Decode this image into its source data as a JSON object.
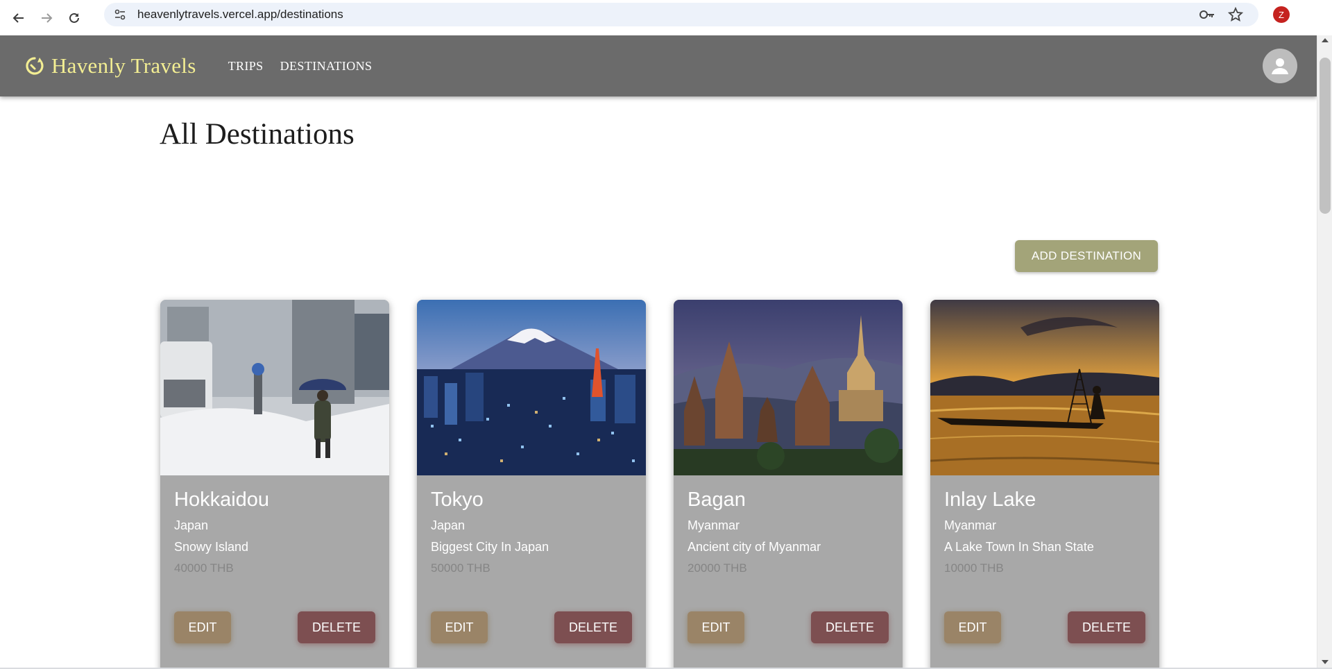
{
  "browser": {
    "url": "heavenlytravels.vercel.app/destinations",
    "profile_initial": "Z"
  },
  "appbar": {
    "brand_name": "Havenly Travels",
    "menu": [
      {
        "label": "TRIPS"
      },
      {
        "label": "DESTINATIONS"
      }
    ]
  },
  "page": {
    "title": "All Destinations",
    "add_button": "ADD DESTINATION"
  },
  "cards": [
    {
      "name": "Hokkaidou",
      "country": "Japan",
      "description": "Snowy Island",
      "price": "40000 THB",
      "edit_label": "EDIT",
      "delete_label": "DELETE",
      "image": "snowy-street-photo"
    },
    {
      "name": "Tokyo",
      "country": "Japan",
      "description": "Biggest City In Japan",
      "price": "50000 THB",
      "edit_label": "EDIT",
      "delete_label": "DELETE",
      "image": "mount-fuji-city-photo"
    },
    {
      "name": "Bagan",
      "country": "Myanmar",
      "description": "Ancient city of Myanmar",
      "price": "20000 THB",
      "edit_label": "EDIT",
      "delete_label": "DELETE",
      "image": "pagodas-photo"
    },
    {
      "name": "Inlay Lake",
      "country": "Myanmar",
      "description": "A Lake Town In Shan State",
      "price": "10000 THB",
      "edit_label": "EDIT",
      "delete_label": "DELETE",
      "image": "lake-sunset-photo"
    }
  ],
  "colors": {
    "appbar": "#6b6b6b",
    "brand": "#f3ee93",
    "add_button": "#a3a479",
    "card": "#a8a8a8",
    "edit_button": "#9a8467",
    "delete_button": "#7d4f51"
  }
}
